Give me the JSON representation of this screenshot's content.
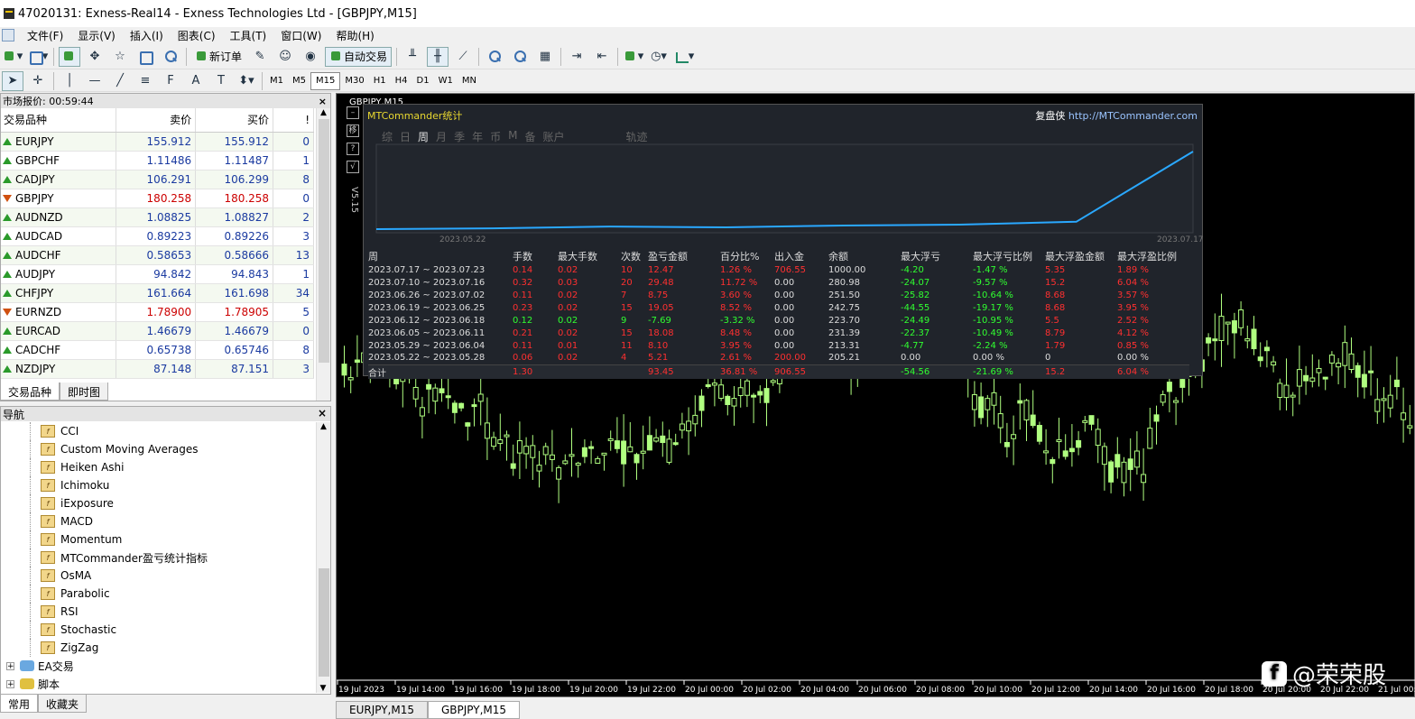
{
  "window": {
    "title": "47020131: Exness-Real14 - Exness Technologies Ltd - [GBPJPY,M15]"
  },
  "menu": [
    "文件(F)",
    "显示(V)",
    "插入(I)",
    "图表(C)",
    "工具(T)",
    "窗口(W)",
    "帮助(H)"
  ],
  "toolbar": {
    "new_order": "新订单",
    "auto_trade": "自动交易",
    "timeframes": [
      "M1",
      "M5",
      "M15",
      "M30",
      "H1",
      "H4",
      "D1",
      "W1",
      "MN"
    ],
    "active_tf": "M15"
  },
  "market_watch": {
    "header": "市场报价: 00:59:44",
    "columns": [
      "交易品种",
      "卖价",
      "买价",
      "!"
    ],
    "rows": [
      {
        "sym": "EURJPY",
        "bid": "155.912",
        "ask": "155.912",
        "spread": "0",
        "dir": "up"
      },
      {
        "sym": "GBPCHF",
        "bid": "1.11486",
        "ask": "1.11487",
        "spread": "1",
        "dir": "up"
      },
      {
        "sym": "CADJPY",
        "bid": "106.291",
        "ask": "106.299",
        "spread": "8",
        "dir": "up"
      },
      {
        "sym": "GBPJPY",
        "bid": "180.258",
        "ask": "180.258",
        "spread": "0",
        "dir": "down"
      },
      {
        "sym": "AUDNZD",
        "bid": "1.08825",
        "ask": "1.08827",
        "spread": "2",
        "dir": "up"
      },
      {
        "sym": "AUDCAD",
        "bid": "0.89223",
        "ask": "0.89226",
        "spread": "3",
        "dir": "up"
      },
      {
        "sym": "AUDCHF",
        "bid": "0.58653",
        "ask": "0.58666",
        "spread": "13",
        "dir": "up"
      },
      {
        "sym": "AUDJPY",
        "bid": "94.842",
        "ask": "94.843",
        "spread": "1",
        "dir": "up"
      },
      {
        "sym": "CHFJPY",
        "bid": "161.664",
        "ask": "161.698",
        "spread": "34",
        "dir": "up"
      },
      {
        "sym": "EURNZD",
        "bid": "1.78900",
        "ask": "1.78905",
        "spread": "5",
        "dir": "down"
      },
      {
        "sym": "EURCAD",
        "bid": "1.46679",
        "ask": "1.46679",
        "spread": "0",
        "dir": "up"
      },
      {
        "sym": "CADCHF",
        "bid": "0.65738",
        "ask": "0.65746",
        "spread": "8",
        "dir": "up"
      },
      {
        "sym": "NZDJPY",
        "bid": "87.148",
        "ask": "87.151",
        "spread": "3",
        "dir": "up"
      }
    ],
    "tabs": [
      "交易品种",
      "即时图"
    ]
  },
  "navigator": {
    "header": "导航",
    "indicators": [
      "CCI",
      "Custom Moving Averages",
      "Heiken Ashi",
      "Ichimoku",
      "iExposure",
      "MACD",
      "Momentum",
      "MTCommander盈亏统计指标",
      "OsMA",
      "Parabolic",
      "RSI",
      "Stochastic",
      "ZigZag"
    ],
    "folders": [
      "EA交易",
      "脚本"
    ],
    "tabs": [
      "常用",
      "收藏夹"
    ]
  },
  "chart": {
    "label": "GBPJPY,M15",
    "time_labels": [
      "19 Jul 2023",
      "19 Jul 14:00",
      "19 Jul 16:00",
      "19 Jul 18:00",
      "19 Jul 20:00",
      "19 Jul 22:00",
      "20 Jul 00:00",
      "20 Jul 02:00",
      "20 Jul 04:00",
      "20 Jul 06:00",
      "20 Jul 08:00",
      "20 Jul 10:00",
      "20 Jul 12:00",
      "20 Jul 14:00",
      "20 Jul 16:00",
      "20 Jul 18:00",
      "20 Jul 20:00",
      "20 Jul 22:00",
      "21 Jul 00:00"
    ],
    "tabs": [
      "EURJPY,M15",
      "GBPJPY,M15"
    ],
    "candle_color": "#b0ff80"
  },
  "stats": {
    "title": "MTCommander统计",
    "site_label": "复盘侠",
    "site_url": "http://MTCommander.com",
    "tabs": [
      "综",
      "日",
      "周",
      "月",
      "季",
      "年",
      "币",
      "M",
      "备",
      "账户",
      "轨迹"
    ],
    "active_tab": "周",
    "version": "V5.15",
    "curve": {
      "x_start": "2023.05.22",
      "x_end": "2023.07.17",
      "values": [
        205.21,
        213.31,
        231.39,
        223.7,
        242.75,
        251.5,
        280.98,
        1000.0
      ]
    },
    "headers": [
      "周",
      "手数",
      "最大手数",
      "次数",
      "盈亏金额",
      "百分比%",
      "出入金",
      "余额",
      "最大浮亏",
      "最大浮亏比例",
      "最大浮盈金额",
      "最大浮盈比例"
    ],
    "rows": [
      [
        "2023.07.17 ~ 2023.07.23",
        "0.14",
        "0.02",
        "10",
        "12.47",
        "1.26 %",
        "706.55",
        "1000.00",
        "-4.20",
        "-1.47 %",
        "5.35",
        "1.89 %"
      ],
      [
        "2023.07.10 ~ 2023.07.16",
        "0.32",
        "0.03",
        "20",
        "29.48",
        "11.72 %",
        "0.00",
        "280.98",
        "-24.07",
        "-9.57 %",
        "15.2",
        "6.04 %"
      ],
      [
        "2023.06.26 ~ 2023.07.02",
        "0.11",
        "0.02",
        "7",
        "8.75",
        "3.60 %",
        "0.00",
        "251.50",
        "-25.82",
        "-10.64 %",
        "8.68",
        "3.57 %"
      ],
      [
        "2023.06.19 ~ 2023.06.25",
        "0.23",
        "0.02",
        "15",
        "19.05",
        "8.52 %",
        "0.00",
        "242.75",
        "-44.55",
        "-19.17 %",
        "8.68",
        "3.95 %"
      ],
      [
        "2023.06.12 ~ 2023.06.18",
        "0.12",
        "0.02",
        "9",
        "-7.69",
        "-3.32 %",
        "0.00",
        "223.70",
        "-24.49",
        "-10.95 %",
        "5.5",
        "2.52 %"
      ],
      [
        "2023.06.05 ~ 2023.06.11",
        "0.21",
        "0.02",
        "15",
        "18.08",
        "8.48 %",
        "0.00",
        "231.39",
        "-22.37",
        "-10.49 %",
        "8.79",
        "4.12 %"
      ],
      [
        "2023.05.29 ~ 2023.06.04",
        "0.11",
        "0.01",
        "11",
        "8.10",
        "3.95 %",
        "0.00",
        "213.31",
        "-4.77",
        "-2.24 %",
        "1.79",
        "0.85 %"
      ],
      [
        "2023.05.22 ~ 2023.05.28",
        "0.06",
        "0.02",
        "4",
        "5.21",
        "2.61 %",
        "200.00",
        "205.21",
        "0.00",
        "0.00 %",
        "0",
        "0.00 %"
      ]
    ],
    "row_colors": [
      "r",
      "r",
      "r",
      "r",
      "g",
      "r",
      "r",
      "r"
    ],
    "total": [
      "合计",
      "1.30",
      "",
      "",
      "93.45",
      "36.81 %",
      "906.55",
      "",
      "-54.56",
      "-21.69 %",
      "15.2",
      "6.04 %"
    ]
  },
  "watermark": "@荣荣股"
}
